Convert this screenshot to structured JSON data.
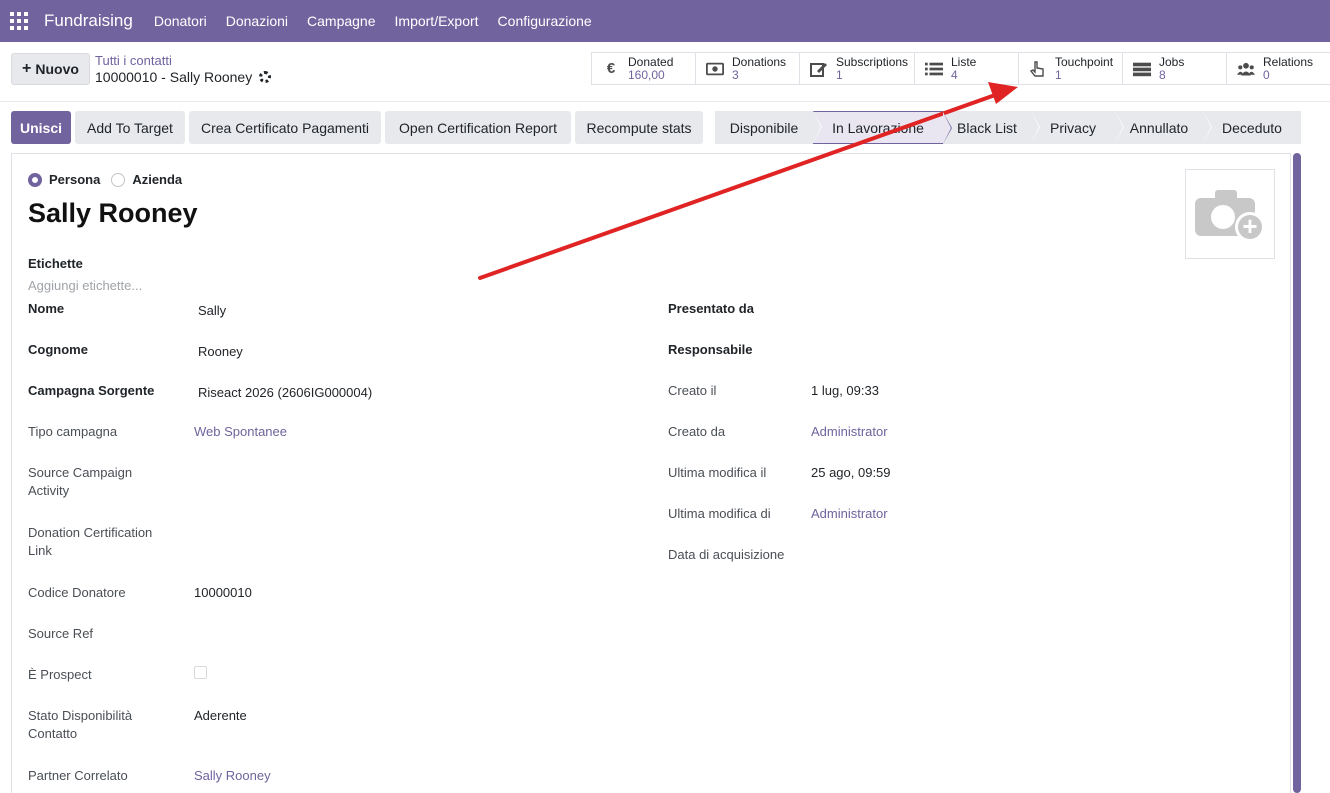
{
  "navbar": {
    "brand": "Fundraising",
    "items": [
      "Donatori",
      "Donazioni",
      "Campagne",
      "Import/Export",
      "Configurazione"
    ]
  },
  "control": {
    "new_label": "Nuovo",
    "breadcrumb": "Tutti i contatti",
    "record": "10000010 - Sally Rooney"
  },
  "smart_buttons": [
    {
      "label": "Donated",
      "value": "160,00",
      "icon": "euro-icon"
    },
    {
      "label": "Donations",
      "value": "3",
      "icon": "money-icon"
    },
    {
      "label": "Subscriptions",
      "value": "1",
      "icon": "edit-icon"
    },
    {
      "label": "Liste",
      "value": "4",
      "icon": "list-icon"
    },
    {
      "label": "Touchpoint",
      "value": "1",
      "icon": "hand-pointer-icon"
    },
    {
      "label": "Jobs",
      "value": "8",
      "icon": "server-icon"
    },
    {
      "label": "Relations",
      "value": "0",
      "icon": "users-icon"
    }
  ],
  "actions": {
    "merge": "Unisci",
    "add_to_target": "Add To Target",
    "create_cert": "Crea Certificato Pagamenti",
    "open_cert": "Open Certification Report",
    "recompute": "Recompute stats"
  },
  "stages": [
    "Disponibile",
    "In Lavorazione",
    "Black List",
    "Privacy",
    "Annullato",
    "Deceduto"
  ],
  "active_stage": "In Lavorazione",
  "form": {
    "type_person": "Persona",
    "type_company": "Azienda",
    "name": "Sally Rooney",
    "tags_label": "Etichette",
    "tags_placeholder": "Aggiungi etichette...",
    "left": {
      "nome_label": "Nome",
      "nome": "Sally",
      "cognome_label": "Cognome",
      "cognome": "Rooney",
      "campagna_label": "Campagna Sorgente",
      "campagna": "Riseact 2026 (2606IG000004)",
      "tipo_label": "Tipo campagna",
      "tipo": "Web Spontanee",
      "sca_label_1": "Source Campaign",
      "sca_label_2": "Activity",
      "dcl_label_1": "Donation Certification",
      "dcl_label_2": "Link",
      "codice_label": "Codice Donatore",
      "codice": "10000010",
      "ref_label": "Source Ref",
      "prospect_label": "È Prospect",
      "stato_label_1": "Stato Disponibilità",
      "stato_label_2": "Contatto",
      "stato": "Aderente",
      "partner_label": "Partner Correlato",
      "partner": "Sally Rooney"
    },
    "right": {
      "presentato_label": "Presentato da",
      "responsabile_label": "Responsabile",
      "creato_il_label": "Creato il",
      "creato_il": "1 lug, 09:33",
      "creato_da_label": "Creato da",
      "creato_da": "Administrator",
      "modifica_il_label": "Ultima modifica il",
      "modifica_il": "25 ago, 09:59",
      "modifica_di_label": "Ultima modifica di",
      "modifica_di": "Administrator",
      "acquisizione_label": "Data di acquisizione"
    }
  },
  "colors": {
    "brand": "#71639e",
    "annotation_arrow": "#e02424"
  }
}
